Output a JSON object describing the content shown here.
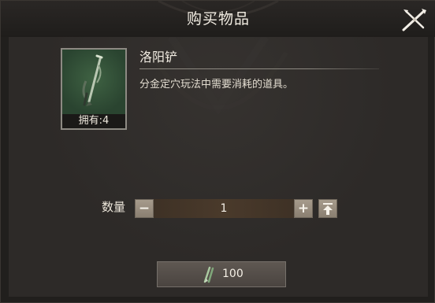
{
  "dialog": {
    "title": "购买物品",
    "close_icon": "close-x-icon"
  },
  "item": {
    "name": "洛阳铲",
    "description": "分金定穴玩法中需要消耗的道具。",
    "owned_text": "拥有:4",
    "image_icon": "luoyang-shovel-icon"
  },
  "quantity": {
    "label": "数量",
    "value": "1",
    "minus_icon": "minus-icon",
    "plus_icon": "plus-icon",
    "max_icon": "max-up-arrow-icon"
  },
  "purchase": {
    "price": "100",
    "currency_icon": "currency-icon"
  },
  "colors": {
    "panel": "#2d2a28",
    "item_bg": "#2f4a32",
    "qty_track": "#4a3a2b",
    "button": "#5a534d"
  }
}
